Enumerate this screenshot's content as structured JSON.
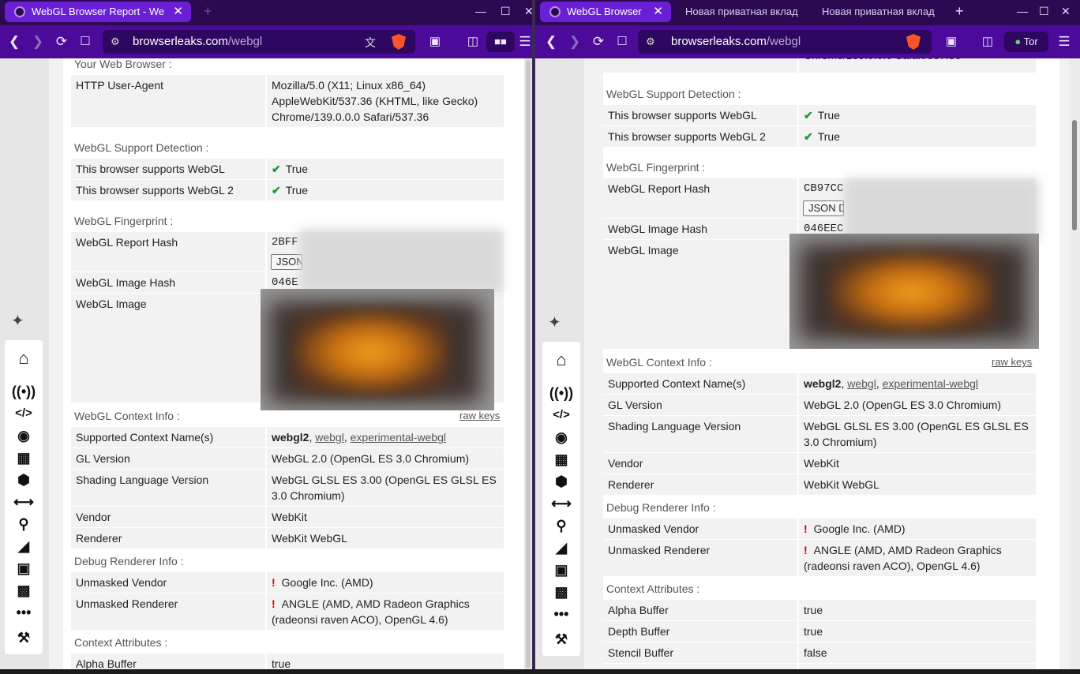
{
  "left": {
    "tabs": [
      {
        "label": "WebGL Browser Report - We",
        "close": "✕"
      }
    ],
    "new_tab": "+",
    "url_host": "browserleaks.com",
    "url_path": "/webgl",
    "window_controls": {
      "min": "—",
      "max": "☐",
      "close": "✕"
    }
  },
  "right": {
    "tabs": [
      {
        "label": "WebGL Browser",
        "close": "✕"
      },
      {
        "label": "Новая приватная вклад"
      },
      {
        "label": "Новая приватная вклад"
      }
    ],
    "new_tab": "+",
    "url_host": "browserleaks.com",
    "url_path": "/webgl",
    "tor_label": "Tor",
    "window_controls": {
      "min": "—",
      "max": "☐",
      "close": "✕"
    }
  },
  "sidebar_icons": [
    "pin-icon",
    "home-icon",
    "broadcast-icon",
    "code-icon",
    "camera-icon",
    "image-icon",
    "cube-icon",
    "text-width-icon",
    "location-pin-icon",
    "stairs-icon",
    "lock-icon",
    "bricks-icon",
    "more-icon",
    "tools-icon"
  ],
  "report": {
    "browser_section": "Your Web Browser :",
    "user_agent_label": "HTTP User-Agent",
    "user_agent_l1": "Mozilla/5.0 (X11; Linux x86_64)",
    "user_agent_l2": "AppleWebKit/537.36 (KHTML, like Gecko)",
    "user_agent_l3": "Chrome/139.0.0.0 Safari/537.36",
    "support_section": "WebGL Support Detection :",
    "supports_webgl": "This browser supports WebGL",
    "supports_webgl2": "This browser supports WebGL 2",
    "check": "✔",
    "true_value": "True",
    "fingerprint_section": "WebGL Fingerprint :",
    "report_hash_label": "WebGL Report Hash",
    "image_hash_label": "WebGL Image Hash",
    "image_label": "WebGL Image",
    "context_section": "WebGL Context Info :",
    "raw_keys": "raw keys",
    "context_names_label": "Supported Context Name(s)",
    "ctx_webgl2": "webgl2",
    "ctx_sep": ", ",
    "ctx_webgl": "webgl",
    "ctx_experimental": "experimental-webgl",
    "gl_version_label": "GL Version",
    "gl_version": "WebGL 2.0 (OpenGL ES 3.0 Chromium)",
    "shading_label": "Shading Language Version",
    "shading_l1": "WebGL GLSL ES 3.00 (OpenGL ES GLSL ES",
    "shading_l2": "3.0 Chromium)",
    "vendor_label": "Vendor",
    "vendor": "WebKit",
    "renderer_label": "Renderer",
    "renderer": "WebKit WebGL",
    "debug_section": "Debug Renderer Info :",
    "unmasked_vendor_label": "Unmasked Vendor",
    "bang": "!",
    "unmasked_vendor": "Google Inc. (AMD)",
    "unmasked_renderer_label": "Unmasked Renderer",
    "unmasked_renderer_l1": "ANGLE (AMD, AMD Radeon Graphics",
    "unmasked_renderer_l2": "(radeonsi raven ACO), OpenGL 4.6)",
    "attributes_section": "Context Attributes :",
    "alpha_buffer_label": "Alpha Buffer",
    "alpha_buffer": "true",
    "depth_buffer_label": "Depth Buffer",
    "depth_buffer": "true",
    "stencil_buffer_label": "Stencil Buffer",
    "stencil_buffer": "false"
  },
  "left_hash": {
    "report": "2BFF",
    "image": "046E",
    "json_button": "JSON"
  },
  "right_hash": {
    "report": "CB97CC",
    "image": "046EEC",
    "json_button": "JSON D"
  },
  "colors": {
    "tabbar": "#2b0a52",
    "navbar": "#4b0a9a",
    "active_tab": "#6b1fd4",
    "check": "#1a9a3a",
    "warning": "#d00000"
  }
}
